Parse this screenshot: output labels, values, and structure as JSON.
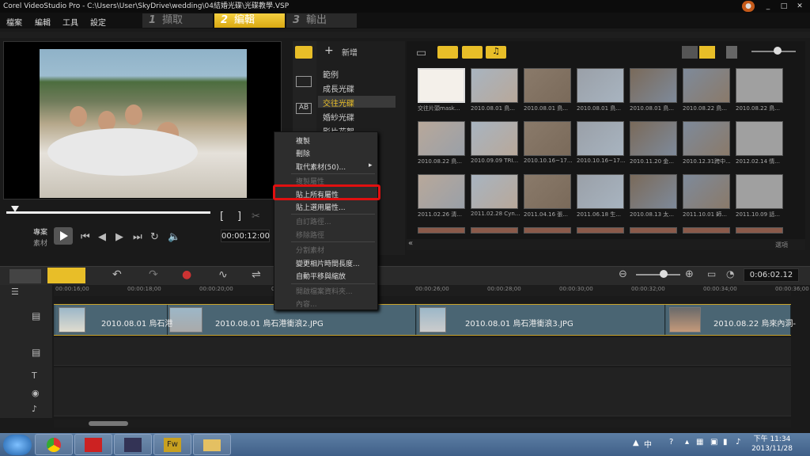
{
  "window": {
    "title": "Corel VideoStudio Pro - C:\\Users\\User\\SkyDrive\\wedding\\04結婚光碟\\光碟教學.VSP",
    "min": "_",
    "max": "□",
    "close": "✕"
  },
  "menus": [
    "檔案",
    "編輯",
    "工具",
    "設定"
  ],
  "steps": [
    {
      "num": "1",
      "label": "擷取"
    },
    {
      "num": "2",
      "label": "編輯"
    },
    {
      "num": "3",
      "label": "輸出"
    }
  ],
  "library": {
    "add_label": "新增",
    "categories": [
      "範例",
      "成長光碟",
      "交往光碟",
      "婚紗光碟",
      "影片花絮"
    ],
    "options_label": "選項",
    "thumbs": [
      "交往片頭mask...",
      "2010.08.01 鳥...",
      "2010.08.01 鳥...",
      "2010.08.01 鳥...",
      "2010.08.01 鳥...",
      "2010.08.22 鳥...",
      "2010.08.22 鳥...",
      "2010.08.22 鳥...",
      "2010.09.09 TRI...",
      "2010.10.16~17...",
      "2010.10.16~17...",
      "2010.11.20 金...",
      "2010.12.31跨中...",
      "2012.02.14 情...",
      "2011.02.26 清...",
      "2011.02.28 Cyn...",
      "2011.04.16 張...",
      "2011.06.18 生...",
      "2010.08.13 太...",
      "2011.10.01 師...",
      "2011.10.09 話..."
    ]
  },
  "player": {
    "project": "專案",
    "clip": "素材",
    "timecode": "00:00:12:00",
    "bracket_in": "[",
    "bracket_out": "]"
  },
  "context_menu": {
    "items": [
      {
        "label": "複製",
        "enabled": true
      },
      {
        "label": "刪除",
        "enabled": true
      },
      {
        "label": "取代素材(50)...",
        "enabled": true,
        "sub": "▸"
      },
      {
        "label": "複製屬性",
        "enabled": false
      },
      {
        "label": "貼上所有屬性",
        "enabled": true,
        "highlighted": true
      },
      {
        "label": "貼上選用屬性...",
        "enabled": true
      },
      {
        "label": "自訂路徑...",
        "enabled": false
      },
      {
        "label": "移除路徑",
        "enabled": false
      },
      {
        "label": "分割素材",
        "enabled": false
      },
      {
        "label": "變更相片時間長度...",
        "enabled": true
      },
      {
        "label": "自動平移與縮放",
        "enabled": true
      },
      {
        "label": "開啟檔案資料夾...",
        "enabled": false
      },
      {
        "label": "內容...",
        "enabled": false
      }
    ]
  },
  "timeline": {
    "total_time": "0:06:02.12",
    "ruler": [
      "00:00:16;00",
      "00:00:18;00",
      "00:00:20;00",
      "00:00:22;00",
      "00:00:24;00",
      "00:00:26;00",
      "00:00:28;00",
      "00:00:30;00",
      "00:00:32;00",
      "00:00:34;00",
      "00:00:36;00"
    ],
    "clips": [
      "2010.08.01 烏石港",
      "2010.08.01 烏石港衝浪2.JPG",
      "2010.08.01 烏石港衝浪3.JPG",
      "2010.08.22 烏來內洞-"
    ]
  },
  "taskbar": {
    "ime": "中",
    "time": "下午 11:34",
    "date": "2013/11/28"
  },
  "colors": {
    "accent": "#e8be28",
    "highlight": "#e01010",
    "track": "#4a6573"
  }
}
